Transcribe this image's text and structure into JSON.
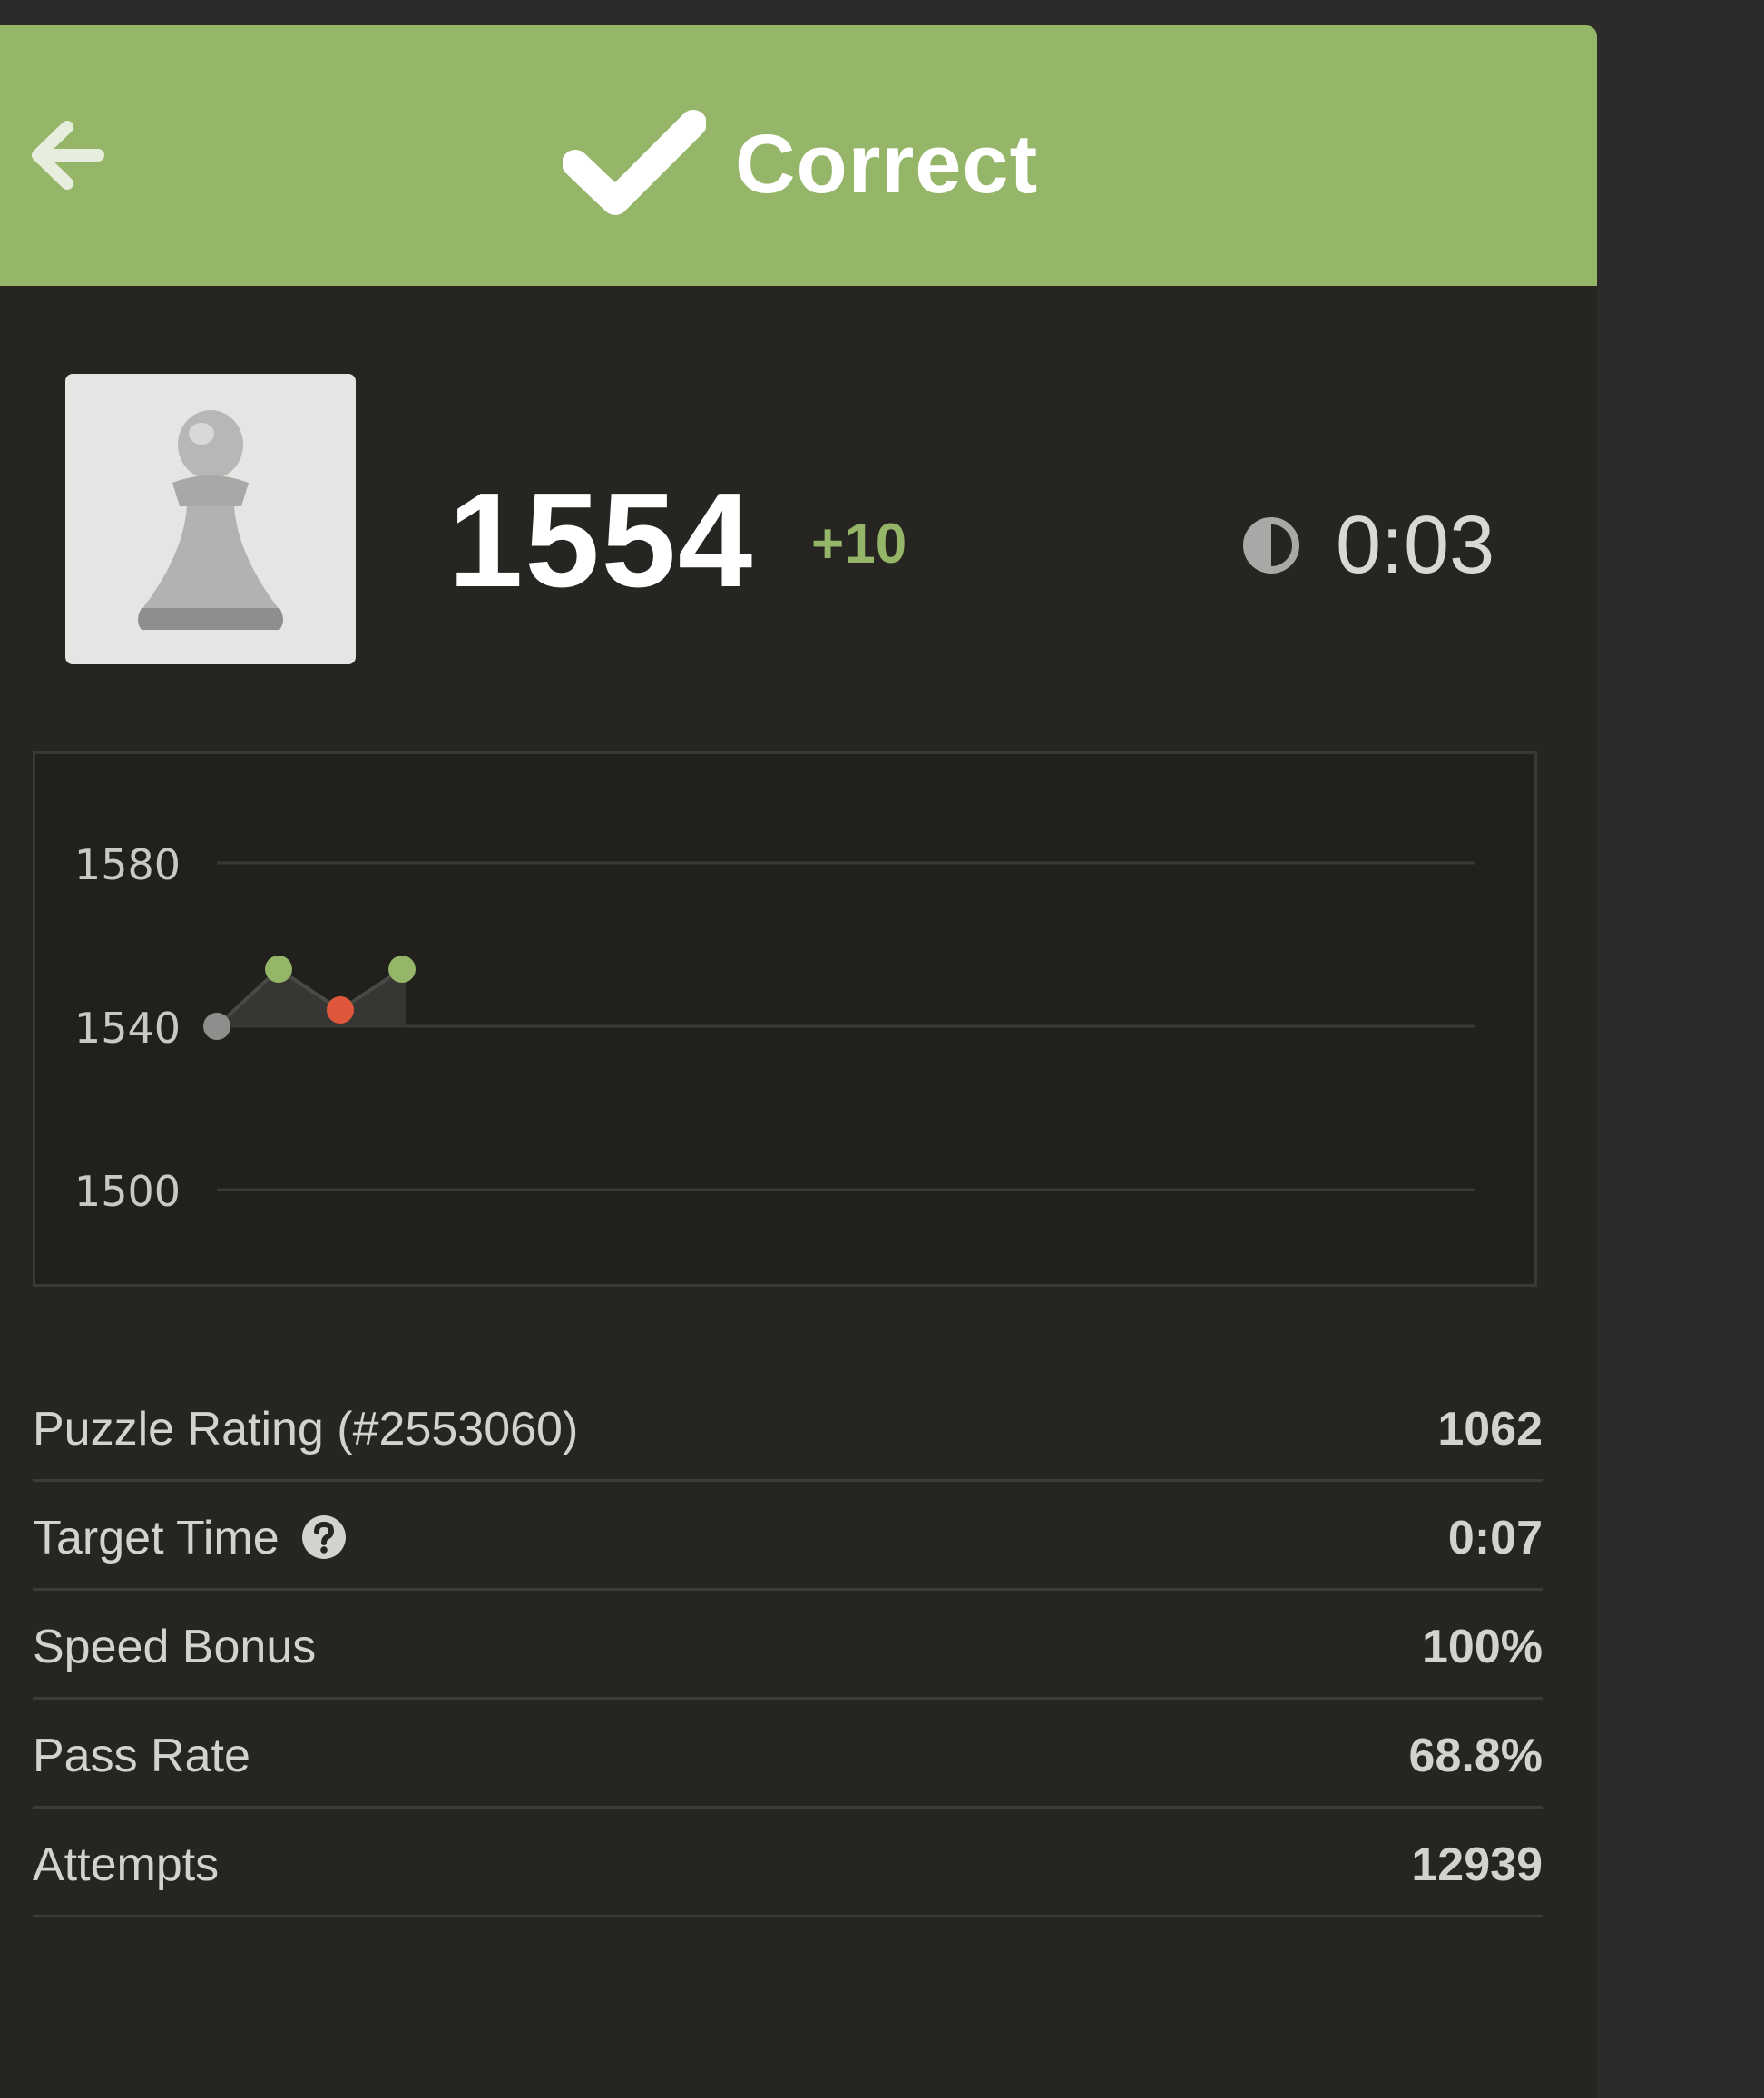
{
  "header": {
    "title": "Correct",
    "back_icon": "arrow-left-icon",
    "check_icon": "checkmark-icon",
    "background_color": "#95b568"
  },
  "player": {
    "avatar_icon": "pawn-icon",
    "rating": "1554",
    "rating_change": "+10",
    "timer_icon": "half-circle-clock-icon",
    "time": "0:03"
  },
  "colors": {
    "win": "#95b568",
    "loss": "#e0583b",
    "neutral": "#8f8e8c"
  },
  "chart_data": {
    "type": "line",
    "title": "",
    "xlabel": "",
    "ylabel": "",
    "ylim": [
      1500,
      1580
    ],
    "yticks": [
      "1580",
      "1540",
      "1500"
    ],
    "grid": true,
    "series": [
      {
        "x": [
          1,
          2,
          3,
          4
        ],
        "y": [
          1540,
          1554,
          1544,
          1554
        ],
        "point_results": [
          "start",
          "win",
          "loss",
          "win"
        ]
      }
    ]
  },
  "stats": [
    {
      "label": "Puzzle Rating (#2553060)",
      "value": "1062"
    },
    {
      "label": "Target Time",
      "value": "0:07",
      "help_icon": "question-circle-icon"
    },
    {
      "label": "Speed Bonus",
      "value": "100%"
    },
    {
      "label": "Pass Rate",
      "value": "68.8%"
    },
    {
      "label": "Attempts",
      "value": "12939"
    }
  ]
}
